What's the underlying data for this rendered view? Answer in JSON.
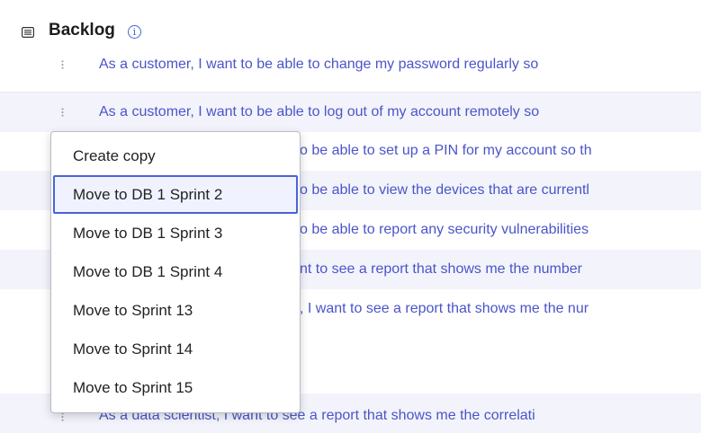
{
  "backlog": {
    "title": "Backlog",
    "info_icon": "info-icon",
    "list_icon": "list-icon"
  },
  "rows": [
    {
      "text": "As a customer, I want to be able to change my password regularly so"
    },
    {
      "text": "As a customer, I want to be able to log out of my account remotely so"
    },
    {
      "text": "o be able to set up a PIN for my account so th"
    },
    {
      "text": "o be able to view the devices that are currentl"
    },
    {
      "text": "o be able to report any security vulnerabilities"
    },
    {
      "text": "nt to see a report that shows me the number"
    },
    {
      "text": ", I want to see a report that shows me the nur"
    },
    {
      "text": "As a data scientist, I want to see a report that shows me the correlati"
    }
  ],
  "context_menu": {
    "items": [
      "Create copy",
      "Move to DB 1 Sprint 2",
      "Move to DB 1 Sprint 3",
      "Move to DB 1 Sprint 4",
      "Move to Sprint 13",
      "Move to Sprint 14",
      "Move to Sprint 15"
    ],
    "active_index": 1
  },
  "colors": {
    "accent": "#4a63d8",
    "story_text": "#4a55c9",
    "row_alt_bg": "#f3f4fb"
  }
}
